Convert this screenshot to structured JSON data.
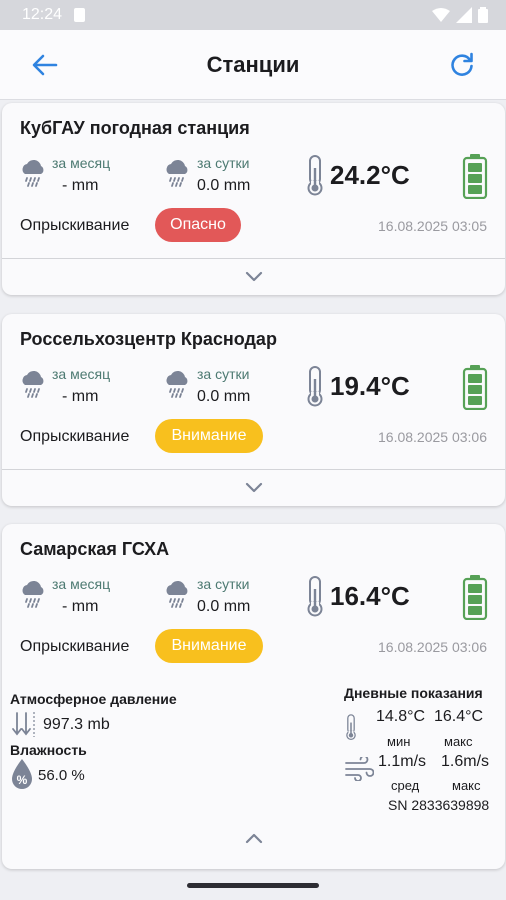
{
  "status_bar": {
    "time": "12:24"
  },
  "header": {
    "title": "Станции"
  },
  "labels": {
    "month": "за месяц",
    "day": "за сутки",
    "spraying": "Опрыскивание"
  },
  "stations": [
    {
      "name": "КубГАУ погодная станция",
      "rain_month": "- mm",
      "rain_day": "0.0 mm",
      "temperature": "24.2°C",
      "spray_status": "Опасно",
      "spray_color": "#e25858",
      "datetime": "16.08.2025 03:05"
    },
    {
      "name": "Россельхозцентр Краснодар",
      "rain_month": "- mm",
      "rain_day": "0.0 mm",
      "temperature": "19.4°C",
      "spray_status": "Внимание",
      "spray_color": "#f8c01e",
      "datetime": "16.08.2025 03:06"
    },
    {
      "name": "Самарская ГСХА",
      "rain_month": "- mm",
      "rain_day": "0.0 mm",
      "temperature": "16.4°C",
      "spray_status": "Внимание",
      "spray_color": "#f8c01e",
      "datetime": "16.08.2025 03:06"
    }
  ],
  "details": {
    "pressure_label": "Атмосферное давление",
    "pressure_value": "997.3 mb",
    "humidity_label": "Влажность",
    "humidity_value": "56.0 %",
    "daily_label": "Дневные показания",
    "temp_min": "14.8°C",
    "temp_max": "16.4°C",
    "min_label": "мин",
    "max_label": "макс",
    "wind_avg": "1.1m/s",
    "wind_max": "1.6m/s",
    "avg_label": "сред",
    "wind_max_label": "макс",
    "serial": "SN 2833639898"
  },
  "colors": {
    "accent": "#2f83e0",
    "battery": "#56a156",
    "icon": "#7c8496"
  }
}
